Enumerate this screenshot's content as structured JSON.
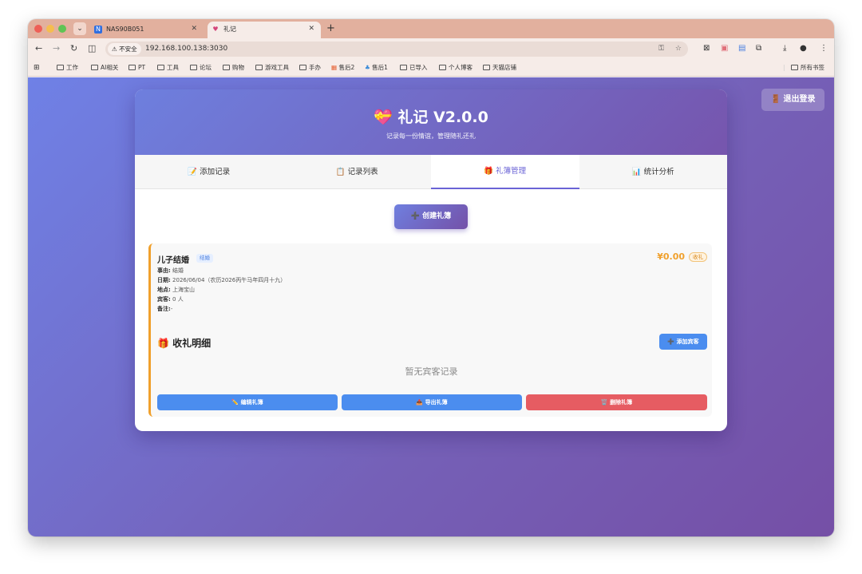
{
  "browser": {
    "tabs": [
      {
        "title": "NAS90B051",
        "icon": "nas-favicon-icon"
      },
      {
        "title": "礼记",
        "icon": "gift-heart-favicon-icon"
      }
    ],
    "security_label": "不安全",
    "url": "192.168.100.138:3030",
    "bookmarks": [
      "工作",
      "AI相关",
      "PT",
      "工具",
      "论坛",
      "购物",
      "游戏工具",
      "手办",
      "售后2",
      "售后1",
      "已导入",
      "个人博客",
      "天猫店铺"
    ],
    "all_bookmarks": "所有书签"
  },
  "header": {
    "logout_label": "🚪 退出登录",
    "title": "💝 礼记 V2.0.0",
    "subtitle": "记录每一份情谊，管理随礼还礼"
  },
  "nav": {
    "tabs": [
      "📝 添加记录",
      "📋 记录列表",
      "🎁 礼簿管理",
      "📊 统计分析"
    ],
    "active_index": 2
  },
  "main": {
    "create_label": "➕ 创建礼簿",
    "book": {
      "name": "儿子结婚",
      "tag": "结婚",
      "amount": "¥0.00",
      "amount_badge": "收礼",
      "reason_label": "事由:",
      "reason": "结婚",
      "date_label": "日期:",
      "date": "2026/06/04（农历2026丙午马年四月十九）",
      "place_label": "地点:",
      "place": "上海宝山",
      "guests_label": "宾客:",
      "guests": "0 人",
      "note_label": "备注:",
      "note": "-",
      "section_title": "🎁 收礼明细",
      "add_guest_label": "➕ 添加宾客",
      "empty_text": "暂无宾客记录",
      "edit_label": "✏️ 编辑礼簿",
      "export_label": "📤 导出礼簿",
      "delete_label": "🗑️ 删除礼簿"
    }
  },
  "colors": {
    "accent": "#6a63d6",
    "amount": "#f0a02c",
    "primary_button": "#4b8def",
    "danger_button": "#e65c62"
  }
}
